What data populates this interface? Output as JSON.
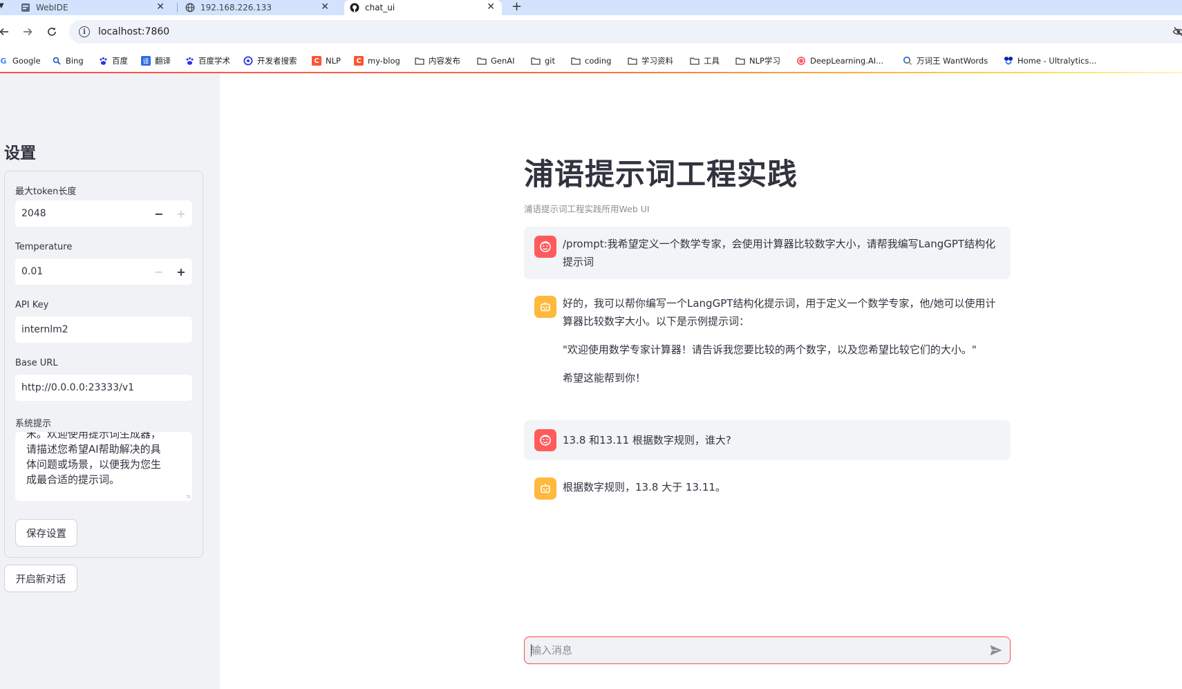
{
  "browser": {
    "tabs": [
      {
        "title": "WebIDE",
        "icon": "webide-icon"
      },
      {
        "title": "192.168.226.133",
        "icon": "globe-icon"
      },
      {
        "title": "chat_ui",
        "icon": "github-icon"
      }
    ],
    "active_tab": 2,
    "url": "localhost:7860",
    "bookmarks": [
      {
        "label": "Google",
        "icon": "google-icon"
      },
      {
        "label": "Bing",
        "icon": "search-icon"
      },
      {
        "label": "百度",
        "icon": "baidu-paw-icon"
      },
      {
        "label": "翻译",
        "icon": "translate-icon"
      },
      {
        "label": "百度学术",
        "icon": "baidu-paw-icon"
      },
      {
        "label": "开发者搜索",
        "icon": "dev-search-icon"
      },
      {
        "label": "NLP",
        "icon": "csdn-icon"
      },
      {
        "label": "my-blog",
        "icon": "csdn-icon"
      },
      {
        "label": "内容发布",
        "icon": "folder-icon"
      },
      {
        "label": "GenAI",
        "icon": "folder-icon"
      },
      {
        "label": "git",
        "icon": "folder-icon"
      },
      {
        "label": "coding",
        "icon": "folder-icon"
      },
      {
        "label": "学习资料",
        "icon": "folder-icon"
      },
      {
        "label": "工具",
        "icon": "folder-icon"
      },
      {
        "label": "NLP学习",
        "icon": "folder-icon"
      },
      {
        "label": "DeepLearning.AI...",
        "icon": "deeplearning-icon"
      },
      {
        "label": "万词王 WantWords",
        "icon": "wantwords-icon"
      },
      {
        "label": "Home - Ultralytics...",
        "icon": "ultralytics-icon"
      }
    ]
  },
  "sidebar": {
    "title": "设置",
    "max_tokens": {
      "label": "最大token长度",
      "value": "2048"
    },
    "temperature": {
      "label": "Temperature",
      "value": "0.01"
    },
    "api_key": {
      "label": "API Key",
      "value": "internlm2"
    },
    "base_url": {
      "label": "Base URL",
      "value": "http://0.0.0.0:23333/v1"
    },
    "system_prompt": {
      "label": "系统提示",
      "lines": [
        "米。欢迎使用提示词生成器，",
        "请描述您希望AI帮助解决的具",
        "体问题或场景，以便我为您生",
        "成最合适的提示词。"
      ]
    },
    "save_button": "保存设置",
    "new_chat_button": "开启新对话"
  },
  "main": {
    "title": "浦语提示词工程实践",
    "caption": "浦语提示词工程实践所用Web UI",
    "messages": [
      {
        "role": "user",
        "paragraphs": [
          "/prompt:我希望定义一个数学专家，会使用计算器比较数字大小，请帮我编写LangGPT结构化提示词"
        ]
      },
      {
        "role": "assistant",
        "paragraphs": [
          "好的，我可以帮你编写一个LangGPT结构化提示词，用于定义一个数学专家，他/她可以使用计算器比较数字大小。以下是示例提示词：",
          "\"欢迎使用数学专家计算器！请告诉我您要比较的两个数字，以及您希望比较它们的大小。\"",
          "希望这能帮到你！"
        ]
      },
      {
        "role": "user",
        "paragraphs": [
          "13.8 和13.11 根据数字规则，谁大?"
        ]
      },
      {
        "role": "assistant",
        "paragraphs": [
          "根据数字规则，13.8 大于 13.11。"
        ]
      }
    ],
    "chat_input": {
      "placeholder": "输入消息"
    }
  },
  "colors": {
    "accent": "#ff4b4b",
    "user_avatar": "#ff5b5b",
    "assistant_avatar": "#ffb93c",
    "sidebar_bg": "#f0f2f6",
    "tabstrip_bg": "#d3e3fd"
  }
}
